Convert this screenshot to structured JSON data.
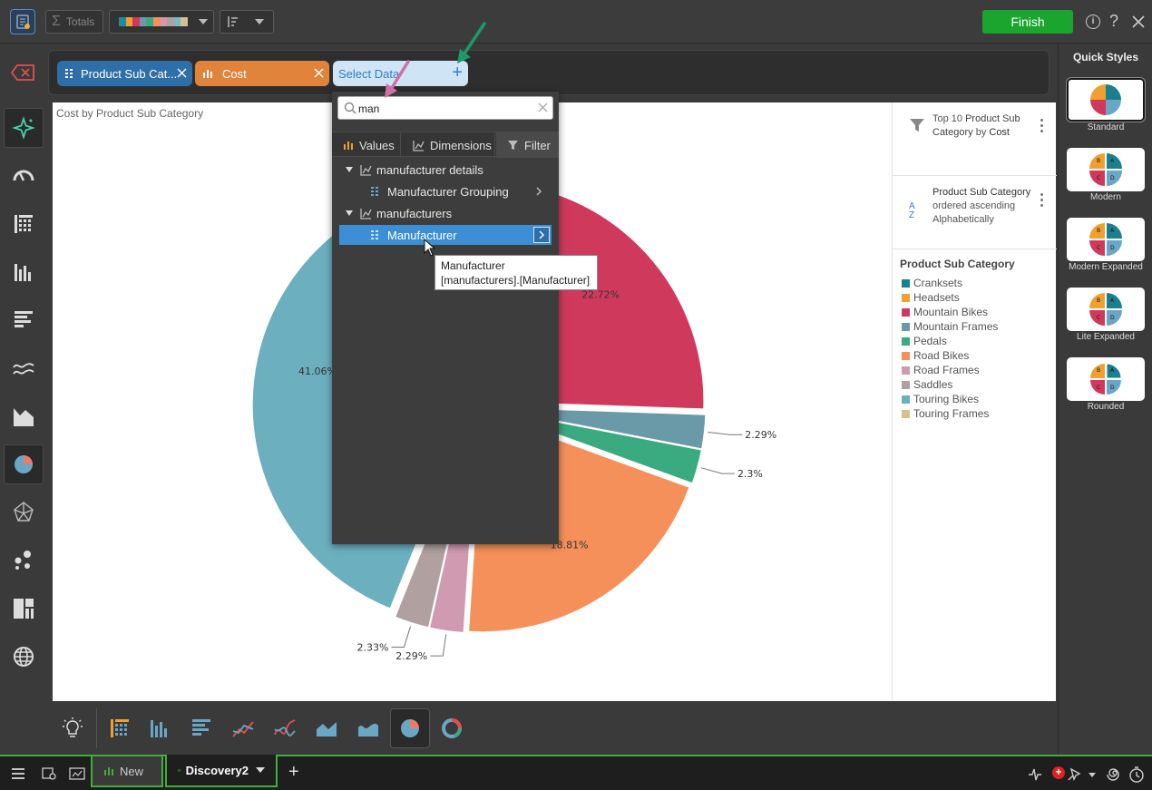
{
  "toolbar": {
    "totals_label": "Totals",
    "finish_label": "Finish",
    "help_glyph": "?",
    "palette": [
      "#1a8ea0",
      "#f0a030",
      "#cf3a5c",
      "#6a9aa8",
      "#3aaa80",
      "#f5905a",
      "#d09ab0",
      "#b0a0a0",
      "#7ab8c8",
      "#d4c090"
    ]
  },
  "fieldbar": {
    "chip1_label": "Product Sub Cat...",
    "chip2_label": "Cost",
    "select_data_label": "Select Data",
    "plus_glyph": "+"
  },
  "chart": {
    "title": "Cost by Product Sub Category"
  },
  "chart_data": {
    "type": "pie",
    "title": "Cost by Product Sub Category",
    "categories": [
      "Cranksets",
      "Headsets",
      "Mountain Bikes",
      "Mountain Frames",
      "Pedals",
      "Road Bikes",
      "Road Frames",
      "Saddles",
      "Touring Bikes",
      "Touring Frames"
    ],
    "values": [
      null,
      null,
      22.72,
      2.29,
      2.3,
      18.81,
      2.29,
      2.33,
      41.06,
      null
    ],
    "labels_visible": [
      "22.72%",
      "2.29%",
      "2.3%",
      "18.81%",
      "2.29%",
      "2.33%",
      "41.06%"
    ],
    "colors": [
      "#1a8090",
      "#f0a030",
      "#cf3a5c",
      "#6a9aa8",
      "#3aaa80",
      "#f5905a",
      "#d09ab0",
      "#b0a0a0",
      "#6cb0c0",
      "#d4c090"
    ],
    "legend_position": "right",
    "legend_title": "Product Sub Category"
  },
  "right_panel": {
    "filter_text_a": "Top 10 ",
    "filter_text_b": "Product Sub Category",
    "filter_text_c": " by ",
    "filter_text_d": "Cost",
    "sort_text_a": "Product Sub Category",
    "sort_text_b": " ordered ascending Alphabetically",
    "sort_az": "A",
    "sort_z": "Z"
  },
  "dropdown": {
    "search_value": "man",
    "tabs": {
      "values": "Values",
      "dimensions": "Dimensions",
      "filter": "Filter"
    },
    "groups": [
      {
        "label": "manufacturer details",
        "items": [
          "Manufacturer Grouping"
        ]
      },
      {
        "label": "manufacturers",
        "items": [
          "Manufacturer"
        ]
      }
    ]
  },
  "tooltip": {
    "line1": "Manufacturer",
    "line2": "[manufacturers].[Manufacturer]"
  },
  "quick_styles": {
    "title": "Quick Styles",
    "items": [
      "Standard",
      "Modern",
      "Modern Expanded",
      "Lite Expanded",
      "Rounded"
    ],
    "quadrant_letters": [
      "A",
      "B",
      "C",
      "D"
    ]
  },
  "status": {
    "tab1": "New",
    "tab2": "Discovery2",
    "add_glyph": "+"
  }
}
